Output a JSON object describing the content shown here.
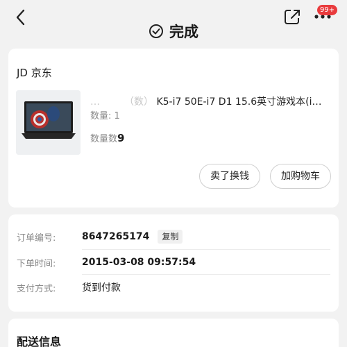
{
  "header": {
    "badge": "99+",
    "status": "完成"
  },
  "product": {
    "shop": "JD 京东",
    "title_blur": "…　　　（数）",
    "title": "K5-i7 50E-i7 D1 15.6英寸游戏本(i…",
    "quantity": "数量: 1",
    "quantity2_prefix": "数量数",
    "quantity2_value": "9"
  },
  "actions": {
    "sell": "卖了换钱",
    "add_cart": "加购物车"
  },
  "order": {
    "id_label": "订单编号:",
    "id_value": "8647265174",
    "copy": "复制",
    "time_label": "下单时间:",
    "time_value": "2015-03-08 09:57:54",
    "pay_label": "支付方式:",
    "pay_value": "货到付款"
  },
  "delivery": {
    "title": "配送信息"
  },
  "colors": {
    "badge": "#e93b3d",
    "background": "#f2f2f2"
  }
}
